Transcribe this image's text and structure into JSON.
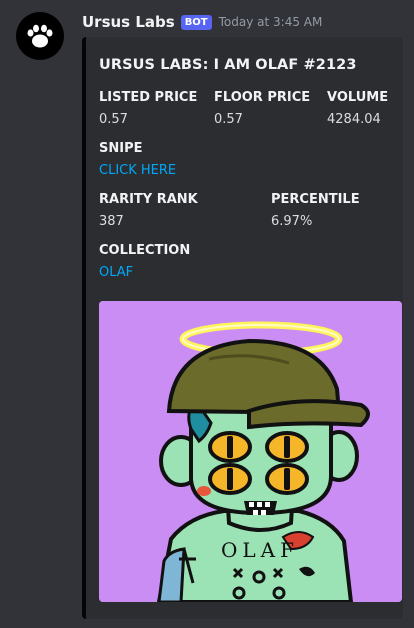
{
  "message": {
    "username": "Ursus Labs",
    "badge": "BOT",
    "timestamp": "Today at 3:45 AM",
    "avatar_icon": "bear-paw-icon"
  },
  "embed": {
    "title": "URSUS LABS: I AM OLAF #2123",
    "border_color": "#050505",
    "fields": {
      "listed_price": {
        "name": "LISTED PRICE",
        "value": "0.57"
      },
      "floor_price": {
        "name": "FLOOR PRICE",
        "value": "0.57"
      },
      "volume": {
        "name": "VOLUME",
        "value": "4284.04"
      },
      "snipe": {
        "name": "SNIPE",
        "link": "CLICK HERE"
      },
      "rarity_rank": {
        "name": "RARITY RANK",
        "value": "387"
      },
      "percentile": {
        "name": "PERCENTILE",
        "value": "6.97%"
      },
      "collection": {
        "name": "COLLECTION",
        "link": "OLAF"
      }
    },
    "image": {
      "tattoo_text": "OLAF",
      "background": "#c98df4"
    }
  },
  "colors": {
    "bg": "#313338",
    "embed_bg": "#2b2d31",
    "link": "#00a8fc",
    "badge": "#5865f2"
  }
}
